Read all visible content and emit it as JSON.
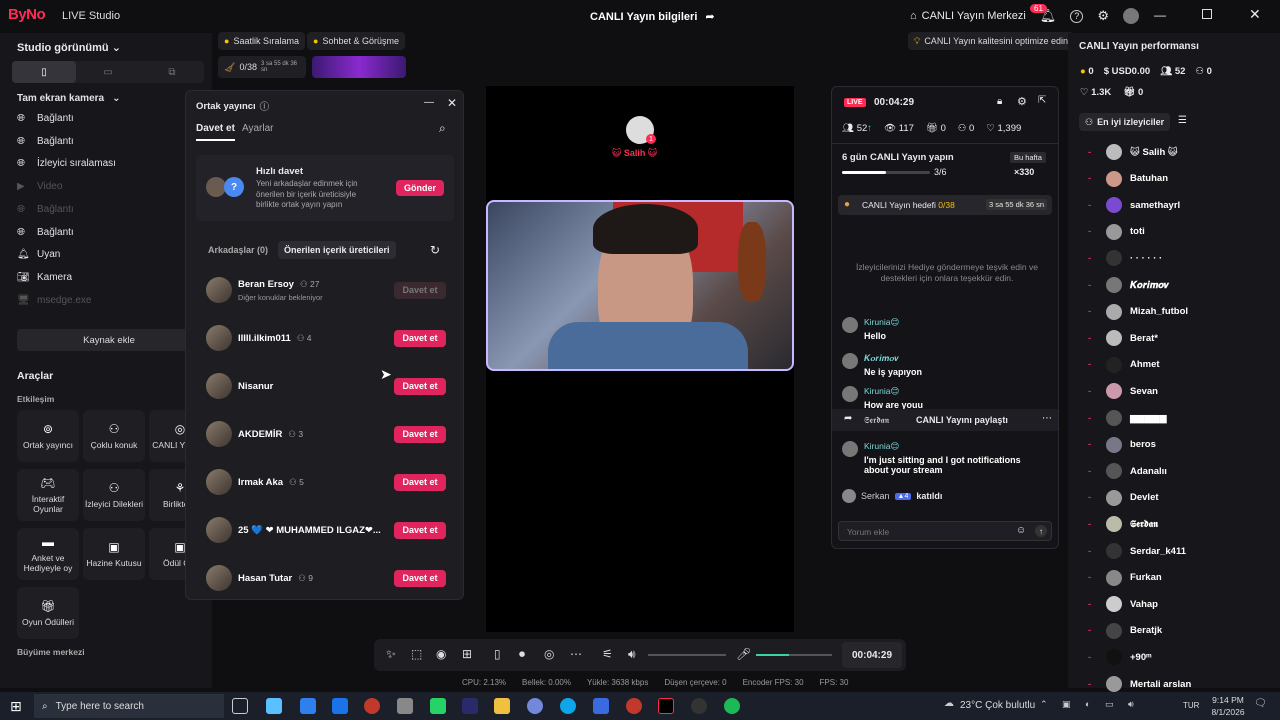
{
  "titlebar": {
    "logo": "ByNo",
    "app_name": "LIVE Studio",
    "center_title": "CANLI Yayın bilgileri",
    "live_center": "CANLI Yayın Merkezi",
    "notif_count": "61"
  },
  "left": {
    "studio_view": "Studio görünümü",
    "camera_label": "Tam ekran kamera",
    "sources": [
      {
        "label": "Bağlantı",
        "dim": false
      },
      {
        "label": "Bağlantı",
        "dim": false
      },
      {
        "label": "İzleyici sıralaması",
        "dim": false
      },
      {
        "label": "Video",
        "dim": true
      },
      {
        "label": "Bağlantı",
        "dim": true
      },
      {
        "label": "Bağlantı",
        "dim": false
      },
      {
        "label": "Uyan",
        "dim": false
      },
      {
        "label": "Kamera",
        "dim": false
      },
      {
        "label": "msedge.exe",
        "dim": true
      }
    ],
    "add_source": "Kaynak ekle",
    "tools_title": "Araçlar",
    "engagement": "Etkileşim",
    "tools": [
      "Ortak yayıncı",
      "Çoklu konuk",
      "CANLI Y Hede",
      "İnteraktif Oyunlar",
      "İzleyici Dilekleri",
      "Birlikte C",
      "Anket ve Hediyeyle oy",
      "Hazine Kutusu",
      "Ödül Çar",
      "Oyun Ödülleri"
    ],
    "growth": "Büyüme merkezi"
  },
  "tags": {
    "hourly": "Saatlik Sıralama",
    "chat": "Sohbet & Görüşme",
    "goal": "0/38",
    "timer": "3 sa 55 dk 36 sn",
    "quality": "CANLI Yayın kalitesini optimize edin"
  },
  "cohost": {
    "title": "Ortak yayıncı",
    "tab_invite": "Davet et",
    "tab_settings": "Ayarlar",
    "quick_title": "Hızlı davet",
    "quick_desc": "Yeni arkadaşlar edinmek için önerilen bir içerik üreticisiyle birlikte ortak yayın yapın",
    "send": "Gönder",
    "friends_tab": "Arkadaşlar (0)",
    "suggested_tab": "Önerilen içerik üreticileri",
    "users": [
      {
        "name": "Beran Ersoy",
        "count": "27",
        "sub": "Diğer konuklar bekleniyor",
        "action": "Davet et",
        "disabled": true
      },
      {
        "name": "IIIIl.ilkim011",
        "count": "4",
        "sub": "",
        "action": "Davet et",
        "disabled": false
      },
      {
        "name": "Nisanur",
        "count": "",
        "sub": "",
        "action": "Davet et",
        "disabled": false
      },
      {
        "name": "AKDEMİR",
        "count": "3",
        "sub": "",
        "action": "Davet et",
        "disabled": false
      },
      {
        "name": "Irmak Aka",
        "count": "5",
        "sub": "",
        "action": "Davet et",
        "disabled": false
      },
      {
        "name": "25 💙 ❤ MUHAMMED ILGAZ❤...",
        "count": "",
        "sub": "",
        "action": "Davet et",
        "disabled": false
      },
      {
        "name": "Hasan Tutar",
        "count": "9",
        "sub": "",
        "action": "Davet et",
        "disabled": false
      }
    ]
  },
  "stage": {
    "host_name": "😺 Salih 😺"
  },
  "chat": {
    "live": "LIVE",
    "time": "00:04:29",
    "stats": {
      "viewers": "52",
      "watch": "117",
      "gifts": "0",
      "joins": "0",
      "likes": "1,399"
    },
    "streak_title": "6 gün CANLI Yayın yapın",
    "streak_tag": "Bu hafta",
    "streak_progress": "3/6",
    "streak_reward": "×330",
    "goal_label": "CANLI Yayın hedefi",
    "goal_val": "0/38",
    "goal_time": "3 sa 55 dk 36 sn",
    "encourage": "İzleyicilerinizi Hediye göndermeye teşvik edin ve destekleri için onlara teşekkür edin.",
    "messages": [
      {
        "who": "Kirunia😊",
        "text": "Hello"
      },
      {
        "who": "𝑲𝒐𝒓𝒊𝒎𝒐𝒗",
        "text": "Ne iş yapıyon"
      },
      {
        "who": "Kirunia😊",
        "text": "How are youu"
      },
      {
        "who": "Kirunia😊",
        "text": "I'm just sitting and I got notifications about your stream"
      }
    ],
    "share_user": "𝕾𝖊𝖗𝖉𝖆𝖓",
    "share_text": "CANLI Yayını paylaştı",
    "join_user": "Serkan",
    "join_text": "katıldı",
    "comment_ph": "Yorum ekle"
  },
  "right": {
    "title": "CANLI Yayın performansı",
    "coins": "0",
    "usd": "USD0.00",
    "viewers": "52",
    "new": "0",
    "likes": "1.3K",
    "gifts": "0",
    "top_viewers": "En iyi izleyiciler",
    "viewers_list": [
      "😺 Salih 😺",
      "Batuhan",
      "samethayrl",
      "toti",
      "· · · · · ·",
      "𝑲𝒐𝒓𝒊𝒎𝒐𝒗",
      "Mizah_futbol",
      "Berat*",
      "Ahmet",
      "Sevan",
      "▆▆▆▆▆",
      "beros",
      "Adanalıı",
      "Devlet",
      "𝕾𝖊𝖗𝖉𝖆𝖓",
      "Serdar_k411",
      "Furkan",
      "Vahap",
      "Beratjk",
      "+90ᵐ",
      "Mertali arslan"
    ]
  },
  "controls": {
    "timer": "00:04:29"
  },
  "stats_bar": {
    "cpu": "CPU: 2.13%",
    "mem": "Bellek: 0.00%",
    "upload": "Yükle: 3638 kbps",
    "dropped": "Düşen çerçeve: 0",
    "enc": "Encoder FPS: 30",
    "fps": "FPS: 30"
  },
  "taskbar": {
    "search_ph": "Type here to search",
    "weather": "23°C  Çok bulutlu",
    "lang": "TUR",
    "time": "9:14 PM",
    "date": "8/1/2026"
  }
}
